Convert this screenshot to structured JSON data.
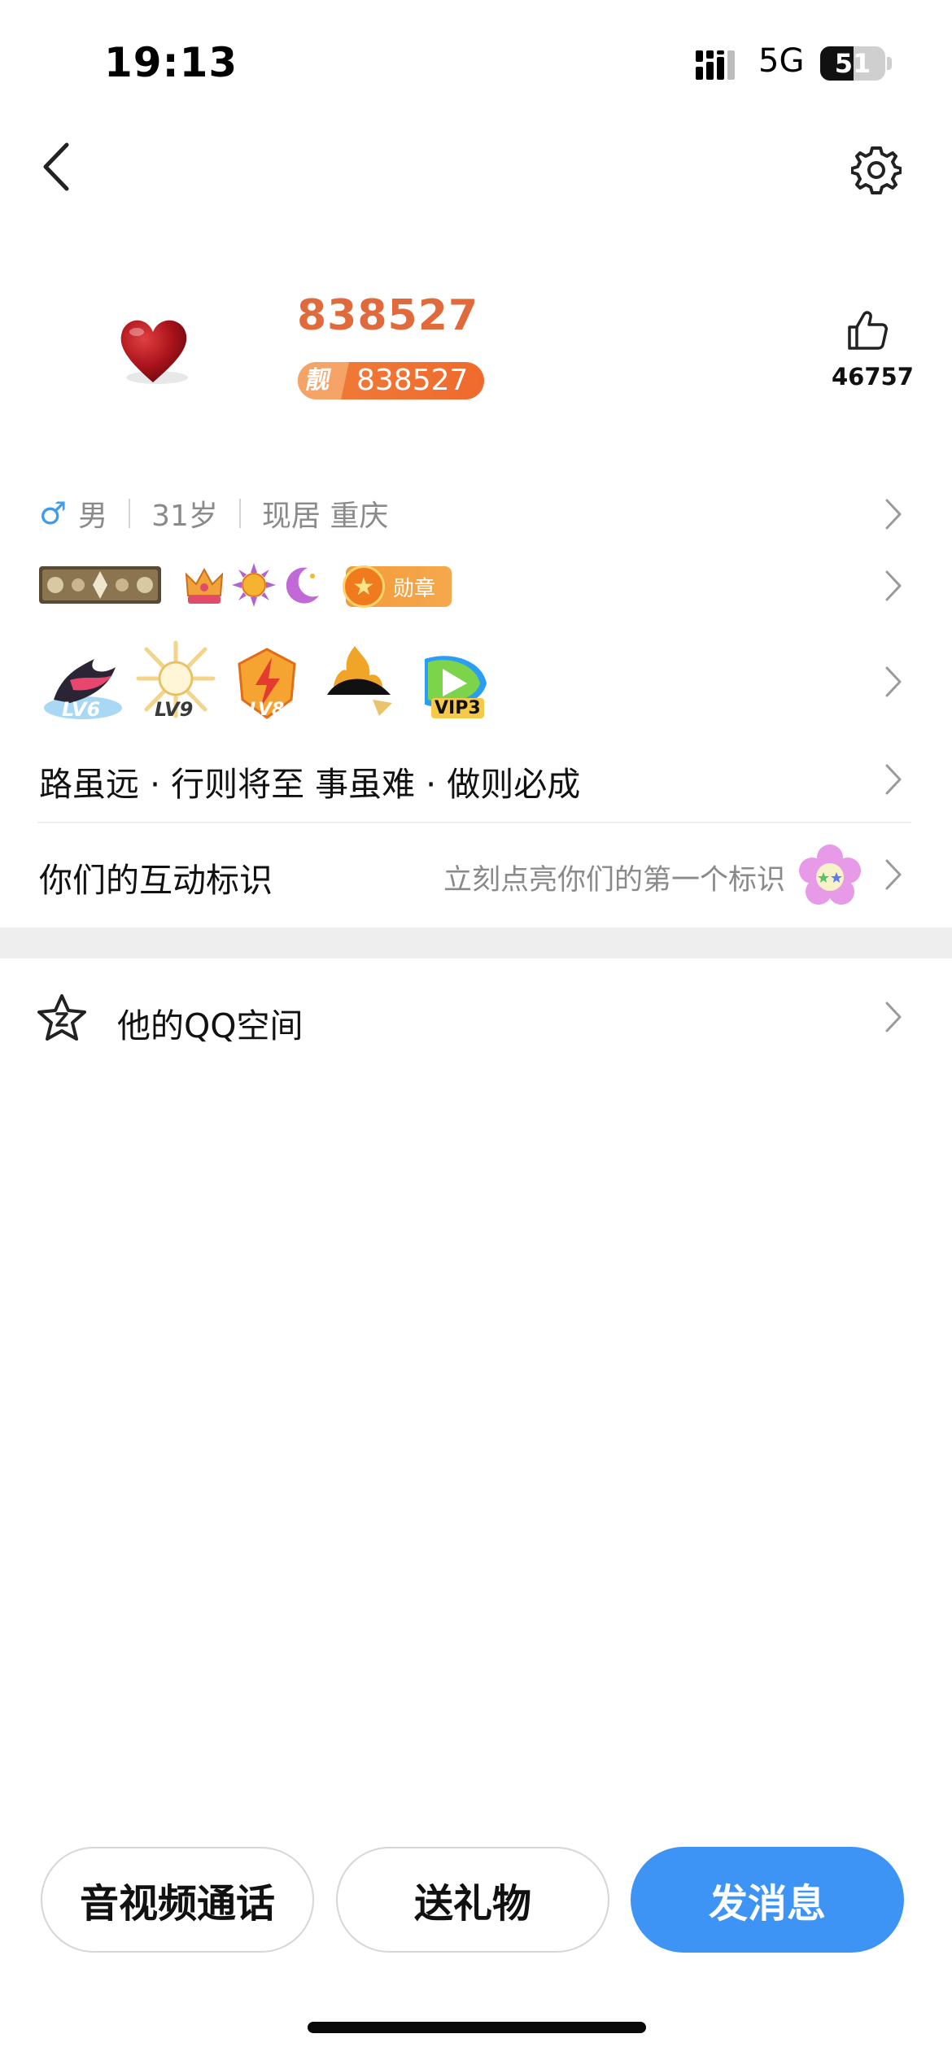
{
  "status_bar": {
    "time": "19:13",
    "network": "5G",
    "battery": "51",
    "battery_level_percent": 51
  },
  "profile": {
    "nickname": "838527",
    "qq_badge_label": "靓",
    "qq_number": "838527",
    "likes": "46757"
  },
  "info": {
    "gender_symbol": "♂",
    "gender": "男",
    "age": "31岁",
    "location": "现居 重庆"
  },
  "badges": {
    "medal_label": "勋章",
    "levels": [
      "LV6",
      "LV9",
      "LV8",
      "VIP3"
    ]
  },
  "motto": "路虽远 · 行则将至 事虽难 · 做则必成",
  "interaction": {
    "title": "你们的互动标识",
    "hint": "立刻点亮你们的第一个标识"
  },
  "qzone": {
    "label": "他的QQ空间"
  },
  "actions": {
    "call": "音视频通话",
    "gift": "送礼物",
    "message": "发消息"
  },
  "colors": {
    "accent_blue": "#3d94f5",
    "nickname_orange": "#e06a3b",
    "male_blue": "#3d9bf0"
  }
}
